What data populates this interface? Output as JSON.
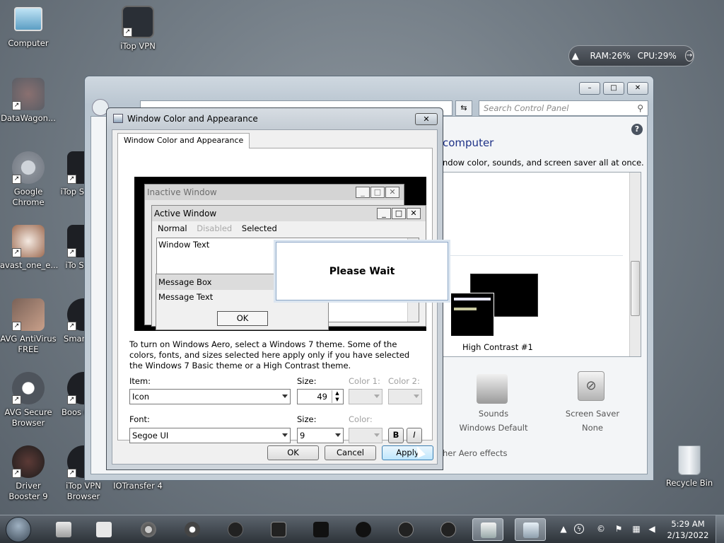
{
  "desktop": {
    "icons": [
      {
        "label": "Computer"
      },
      {
        "label": "iTop VPN"
      },
      {
        "label": "DataWagon..."
      },
      {
        "label": "Google Chrome"
      },
      {
        "label": "iTop S Reco"
      },
      {
        "label": "avast_one_e..."
      },
      {
        "label": "iTo Scree"
      },
      {
        "label": "AVG AntiVirus FREE"
      },
      {
        "label": "Smar Boo"
      },
      {
        "label": "AVG Secure Browser"
      },
      {
        "label": "Boos Gami"
      },
      {
        "label": "Driver Booster 9"
      },
      {
        "label": "iTop VPN Browser"
      },
      {
        "label": "IOTransfer 4"
      },
      {
        "label": "Recycle Bin"
      }
    ]
  },
  "gadget": {
    "ram": "RAM:26%",
    "cpu": "CPU:29%"
  },
  "control_panel": {
    "search_placeholder": "Search Control Panel",
    "heading": "computer",
    "description": "ndow color, sounds, and screen saver all at once.",
    "theme_label": "High Contrast #1",
    "sounds_label": "Sounds",
    "sounds_value": "Windows Default",
    "screensaver_label": "Screen Saver",
    "screensaver_value": "None",
    "aero_link": "her Aero effects"
  },
  "dialog": {
    "title": "Window Color and Appearance",
    "tab": "Window Color and Appearance",
    "preview": {
      "inactive_title": "Inactive Window",
      "active_title": "Active Window",
      "menu_normal": "Normal",
      "menu_disabled": "Disabled",
      "menu_selected": "Selected",
      "window_text": "Window Text",
      "msgbox_title": "Message Box",
      "msgbox_text": "Message Text",
      "msgbox_ok": "OK"
    },
    "info": "To turn on Windows Aero, select a Windows 7 theme.  Some of the colors, fonts, and sizes selected here apply only if you have selected the Windows 7 Basic theme or a High Contrast theme.",
    "item_label": "Item:",
    "item_value": "Icon",
    "size_label": "Size:",
    "size_value": "49",
    "color1_label": "Color 1:",
    "color2_label": "Color 2:",
    "font_label": "Font:",
    "font_value": "Segoe UI",
    "font_size_label": "Size:",
    "font_size_value": "9",
    "font_color_label": "Color:",
    "bold_label": "B",
    "italic_label": "I",
    "ok": "OK",
    "cancel": "Cancel",
    "apply": "Apply"
  },
  "please_wait": "Please Wait",
  "taskbar": {
    "time": "5:29 AM",
    "date": "2/13/2022"
  },
  "colors": {
    "desktop": "#737d86",
    "selection": "#b9d1ea"
  }
}
